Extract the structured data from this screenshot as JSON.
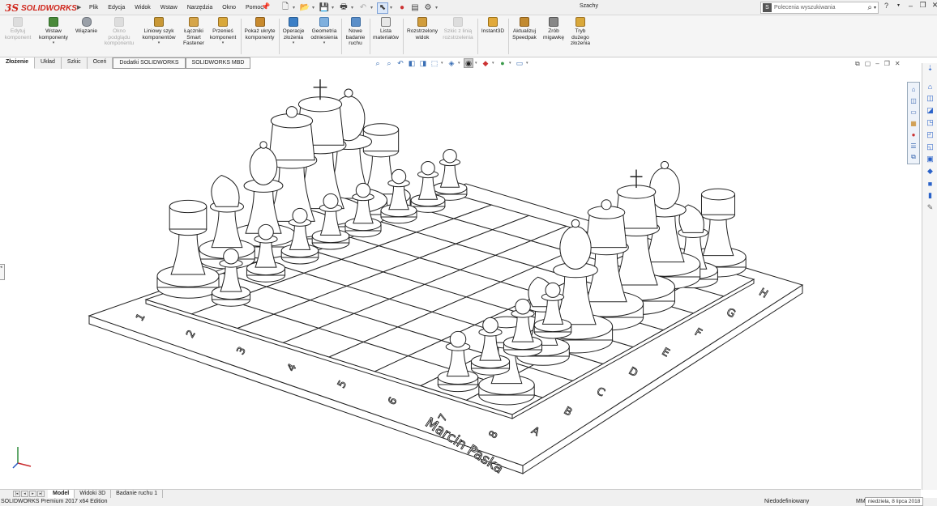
{
  "app": {
    "brand": "SOLIDWORKS",
    "brand_prefix": "3S",
    "doc_title": "Szachy"
  },
  "menu": [
    "Plik",
    "Edycja",
    "Widok",
    "Wstaw",
    "Narzędzia",
    "Okno",
    "Pomoc"
  ],
  "search": {
    "placeholder": "Polecenia wyszukiwania"
  },
  "ribbon": [
    {
      "label": "Edytuj komponent",
      "disabled": true
    },
    {
      "label": "Wstaw komponenty",
      "dropdown": true
    },
    {
      "label": "Wiązanie"
    },
    {
      "label": "Okno podglądu komponentu",
      "disabled": true
    },
    {
      "label": "Liniowy szyk komponentów",
      "dropdown": true
    },
    {
      "label": "Łączniki Smart Fastener"
    },
    {
      "label": "Przenieś komponent",
      "dropdown": true
    },
    {
      "label": "Pokaż ukryte komponenty"
    },
    {
      "label": "Operacje złożenia",
      "dropdown": true
    },
    {
      "label": "Geometria odniesienia",
      "dropdown": true
    },
    {
      "label": "Nowe badanie ruchu"
    },
    {
      "label": "Lista materiałów"
    },
    {
      "label": "Rozstrzelony widok"
    },
    {
      "label": "Szkic z linią rozstrzelenia",
      "disabled": true
    },
    {
      "label": "Instant3D"
    },
    {
      "label": "Aktualizuj Speedpak"
    },
    {
      "label": "Zrób migawkę"
    },
    {
      "label": "Tryb dużego złożenia"
    }
  ],
  "tabs": [
    "Złożenie",
    "Układ",
    "Szkic",
    "Oceń",
    "Dodatki SOLIDWORKS",
    "SOLIDWORKS MBD"
  ],
  "board": {
    "numbers": [
      "1",
      "2",
      "3",
      "4",
      "5",
      "6",
      "7",
      "8"
    ],
    "letters": [
      "A",
      "B",
      "C",
      "D",
      "E",
      "F",
      "G",
      "H"
    ],
    "signature": "Marcin Paska"
  },
  "bottom_tabs": [
    "Model",
    "Widoki 3D",
    "Badanie ruchu 1"
  ],
  "status": {
    "edition": "SOLIDWORKS Premium 2017 x64 Edition",
    "state": "Niedodefiniowany",
    "units": "MM",
    "tooltip": "niedziela, 8 lipca 2018"
  },
  "colors": {
    "brand": "#d0271d",
    "accent": "#3b6fb5"
  }
}
